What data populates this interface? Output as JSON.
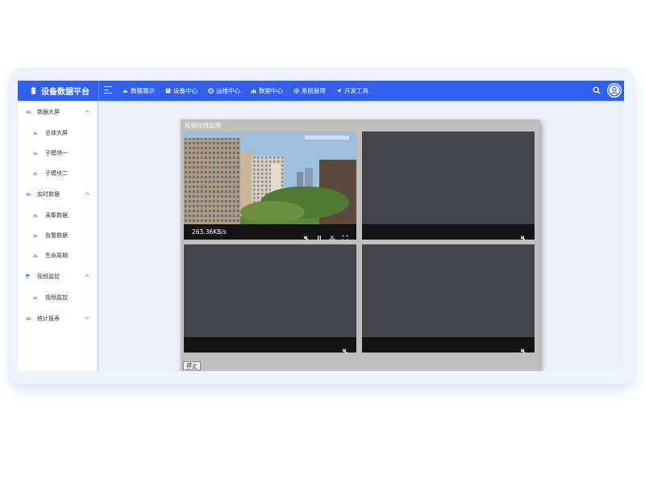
{
  "app": {
    "title": "设备数据平台",
    "brand_color": "#3260ee"
  },
  "nav": {
    "items": [
      {
        "label": "数据展示",
        "icon": "dashboard-icon"
      },
      {
        "label": "设备中心",
        "icon": "device-icon"
      },
      {
        "label": "运维中心",
        "icon": "operations-icon"
      },
      {
        "label": "数据中心",
        "icon": "bar-chart-icon"
      },
      {
        "label": "系统管理",
        "icon": "gear-icon"
      },
      {
        "label": "开发工具",
        "icon": "send-icon"
      }
    ]
  },
  "sidebar": {
    "groups": [
      {
        "label": "数据大屏",
        "expanded": true,
        "items": [
          "总体大屏",
          "子模块一",
          "子模块二"
        ]
      },
      {
        "label": "实时数据",
        "expanded": true,
        "items": [
          "采集数据",
          "告警数据",
          "生命周期"
        ]
      },
      {
        "label": "视频监控",
        "expanded": true,
        "items": [
          "视频监控"
        ]
      },
      {
        "label": "统计报表",
        "expanded": false,
        "items": []
      }
    ]
  },
  "panel": {
    "title": "视频在线监测",
    "stop_label": "停止",
    "videos": [
      {
        "speed": "263.36KB/s",
        "live": true
      },
      {
        "speed": "",
        "live": false
      },
      {
        "speed": "",
        "live": false
      },
      {
        "speed": "",
        "live": false
      }
    ]
  }
}
